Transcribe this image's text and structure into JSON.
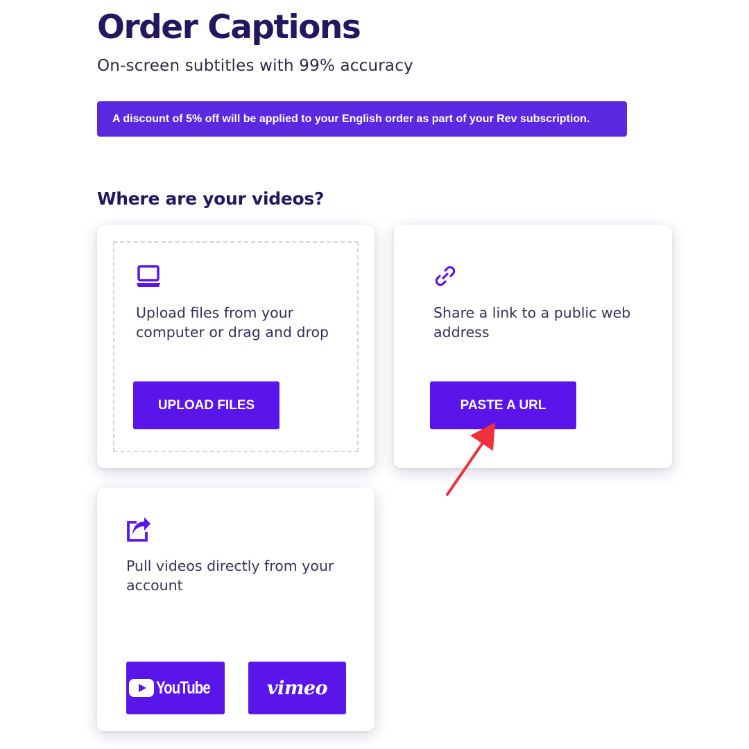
{
  "header": {
    "title": "Order Captions",
    "subtitle": "On-screen subtitles with 99% accuracy"
  },
  "banner": {
    "text": "A discount of 5% off will be applied to your English order as part of your Rev subscription.",
    "color": "#5b2ae0"
  },
  "section": {
    "heading": "Where are your videos?"
  },
  "cards": {
    "upload": {
      "icon": "laptop-icon",
      "line1": "Upload files from your",
      "line2": "computer or drag and drop",
      "button_label": "UPLOAD FILES"
    },
    "url": {
      "icon": "link-icon",
      "line1": "Share a link to a public web",
      "line2": "address",
      "button_label": "PASTE A URL"
    },
    "pull": {
      "icon": "share-icon",
      "line1": "Pull videos directly from your",
      "line2": "account",
      "youtube_label": "YouTube",
      "vimeo_label": "vimeo"
    }
  },
  "colors": {
    "accent": "#5a16ea",
    "title": "#25175f",
    "annotation_arrow": "#f0303a"
  }
}
